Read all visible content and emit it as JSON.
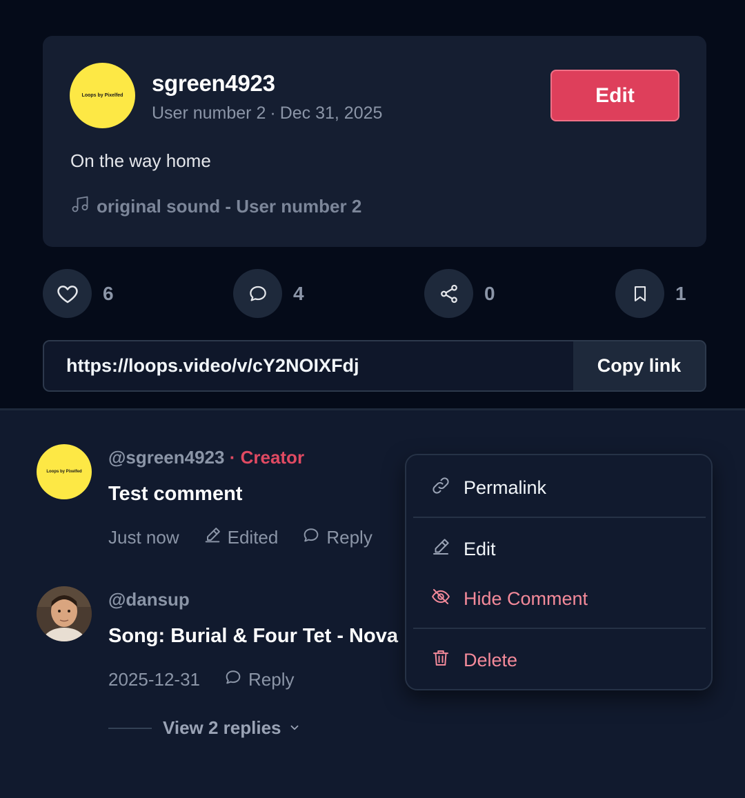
{
  "post": {
    "avatar_text": "Loops by Pixelfed",
    "username": "sgreen4923",
    "display_name": "User number 2",
    "separator": "·",
    "date": "Dec 31, 2025",
    "edit_label": "Edit",
    "caption": "On the way home",
    "sound": "original sound - User number 2"
  },
  "stats": {
    "likes": "6",
    "comments": "4",
    "shares": "0",
    "bookmarks": "1"
  },
  "share": {
    "url": "https://loops.video/v/cY2NOIXFdj",
    "copy_label": "Copy link"
  },
  "comments": [
    {
      "avatar_text": "Loops by Pixelfed",
      "handle": "@sgreen4923",
      "badge": "· Creator",
      "text": "Test comment",
      "time": "Just now",
      "edited_label": "Edited",
      "reply_label": "Reply"
    },
    {
      "handle": "@dansup",
      "text": "Song: Burial & Four Tet - Nova",
      "time": "2025-12-31",
      "reply_label": "Reply",
      "view_replies": "View 2 replies"
    }
  ],
  "menu": {
    "permalink": "Permalink",
    "edit": "Edit",
    "hide": "Hide Comment",
    "delete": "Delete"
  },
  "colors": {
    "accent": "#de3f5b",
    "creator": "#e04a62",
    "danger_text": "#f48a9a",
    "avatar_yellow": "#fde845"
  }
}
